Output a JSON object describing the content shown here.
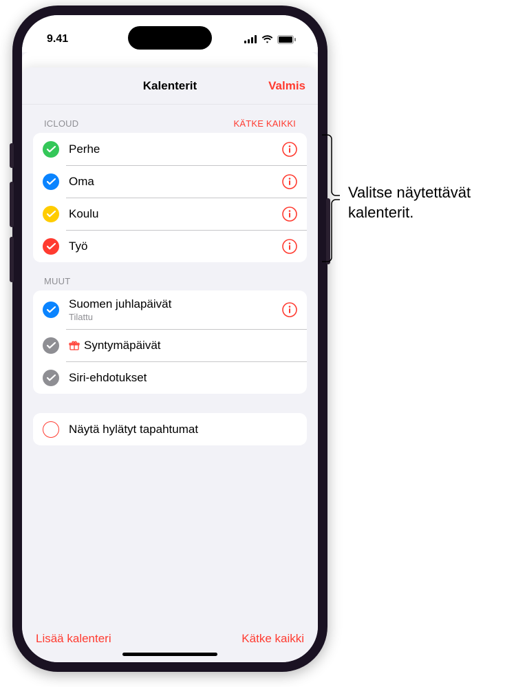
{
  "status": {
    "time": "9.41"
  },
  "sheet": {
    "title": "Kalenterit",
    "done": "Valmis"
  },
  "sections": {
    "icloud": {
      "header": "ICLOUD",
      "action": "KÄTKE KAIKKI",
      "items": [
        {
          "label": "Perhe",
          "color": "#34c759"
        },
        {
          "label": "Oma",
          "color": "#0a84ff"
        },
        {
          "label": "Koulu",
          "color": "#ffcc00"
        },
        {
          "label": "Työ",
          "color": "#ff3b30"
        }
      ]
    },
    "other": {
      "header": "MUUT",
      "items": [
        {
          "label": "Suomen juhlapäivät",
          "sub": "Tilattu",
          "color": "#0a84ff",
          "info": true
        },
        {
          "label": "Syntymäpäivät",
          "color": "#8e8e93",
          "gift": true
        },
        {
          "label": "Siri-ehdotukset",
          "color": "#8e8e93"
        }
      ]
    },
    "declined": {
      "label": "Näytä hylätyt tapahtumat"
    }
  },
  "toolbar": {
    "add": "Lisää kalenteri",
    "hide_all": "Kätke kaikki"
  },
  "callout": {
    "line1": "Valitse näytettävät",
    "line2": "kalenterit."
  }
}
